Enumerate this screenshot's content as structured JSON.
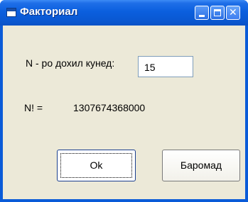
{
  "window": {
    "title": "Факториал",
    "icon": "app-icon"
  },
  "form": {
    "n_label": "N - ро дохил кунед:",
    "n_value": "15",
    "result_label": "N! =",
    "result_value": "1307674368000"
  },
  "buttons": {
    "ok_label": "Ok",
    "cancel_label": "Баромад"
  },
  "colors": {
    "titlebar": "#0a5bd8",
    "client": "#ece9d8"
  }
}
